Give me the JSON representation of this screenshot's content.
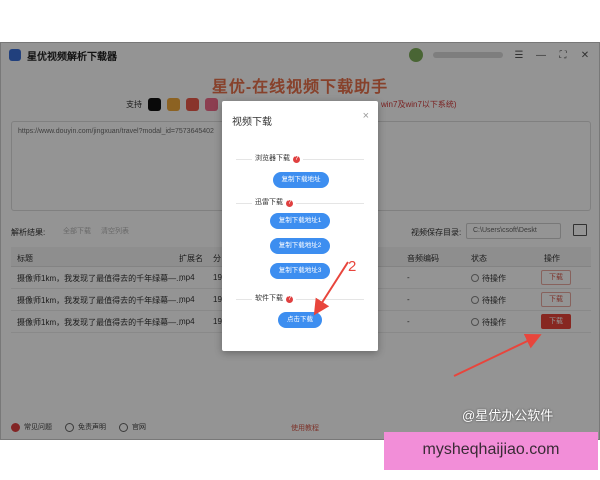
{
  "app": {
    "title": "星优视频解析下载器",
    "hero": "星优-在线视频下载助手",
    "support_label": "支持",
    "support_note": "win7及win7以下系统)",
    "window_controls": [
      "☰",
      "—",
      "⛶",
      "✕"
    ]
  },
  "url_input": {
    "value": "https://www.douyin.com/jingxuan/travel?modal_id=7573645402"
  },
  "results": {
    "label": "解析结果:",
    "faint_buttons": [
      "全部下载",
      "清空列表"
    ],
    "save_label": "视频保存目录:",
    "save_path": "C:\\Users\\csoft\\Deskt"
  },
  "table": {
    "headers": [
      "标题",
      "扩展名",
      "分",
      "音频编码",
      "状态",
      "操作"
    ],
    "rows": [
      {
        "title": "摄像师1km，我发现了最值得去的千年绿幕—...",
        "ext": "mp4",
        "res": "19",
        "audio": "-",
        "status": "待操作",
        "action": "下载"
      },
      {
        "title": "摄像师1km，我发现了最值得去的千年绿幕—...",
        "ext": "mp4",
        "res": "19",
        "audio": "-",
        "status": "待操作",
        "action": "下载"
      },
      {
        "title": "摄像师1km，我发现了最值得去的千年绿幕—...",
        "ext": "mp4",
        "res": "19",
        "audio": "-",
        "status": "待操作",
        "action": "下载"
      }
    ]
  },
  "footer": {
    "items": [
      "常见问题",
      "免责声明",
      "官网"
    ],
    "tutorial": "使用教程"
  },
  "modal": {
    "title": "视频下载",
    "close": "×",
    "section_browser": "浏览器下载",
    "btn_copy": "复制下载地址",
    "section_xunlei": "迅雷下载",
    "btn_addr1": "复制下载地址1",
    "btn_addr2": "复制下载地址2",
    "btn_addr3": "复制下载地址3",
    "section_software": "软件下载",
    "btn_start": "点击下载",
    "help": "?"
  },
  "annotation": {
    "step_number": "2",
    "color": "#e8453c"
  },
  "watermark": "@星优办公软件",
  "site": "mysheqhaijiao.com",
  "colors": {
    "accent_blue": "#3d8ef0",
    "accent_red": "#e8443a",
    "hero_orange": "#e8704a",
    "banner_pink": "#f28ed8"
  },
  "icons": {
    "platforms": [
      "tiktok-icon",
      "weibo-icon",
      "xiaohongshu-icon",
      "bilibili-icon"
    ],
    "folder": "folder-icon"
  }
}
